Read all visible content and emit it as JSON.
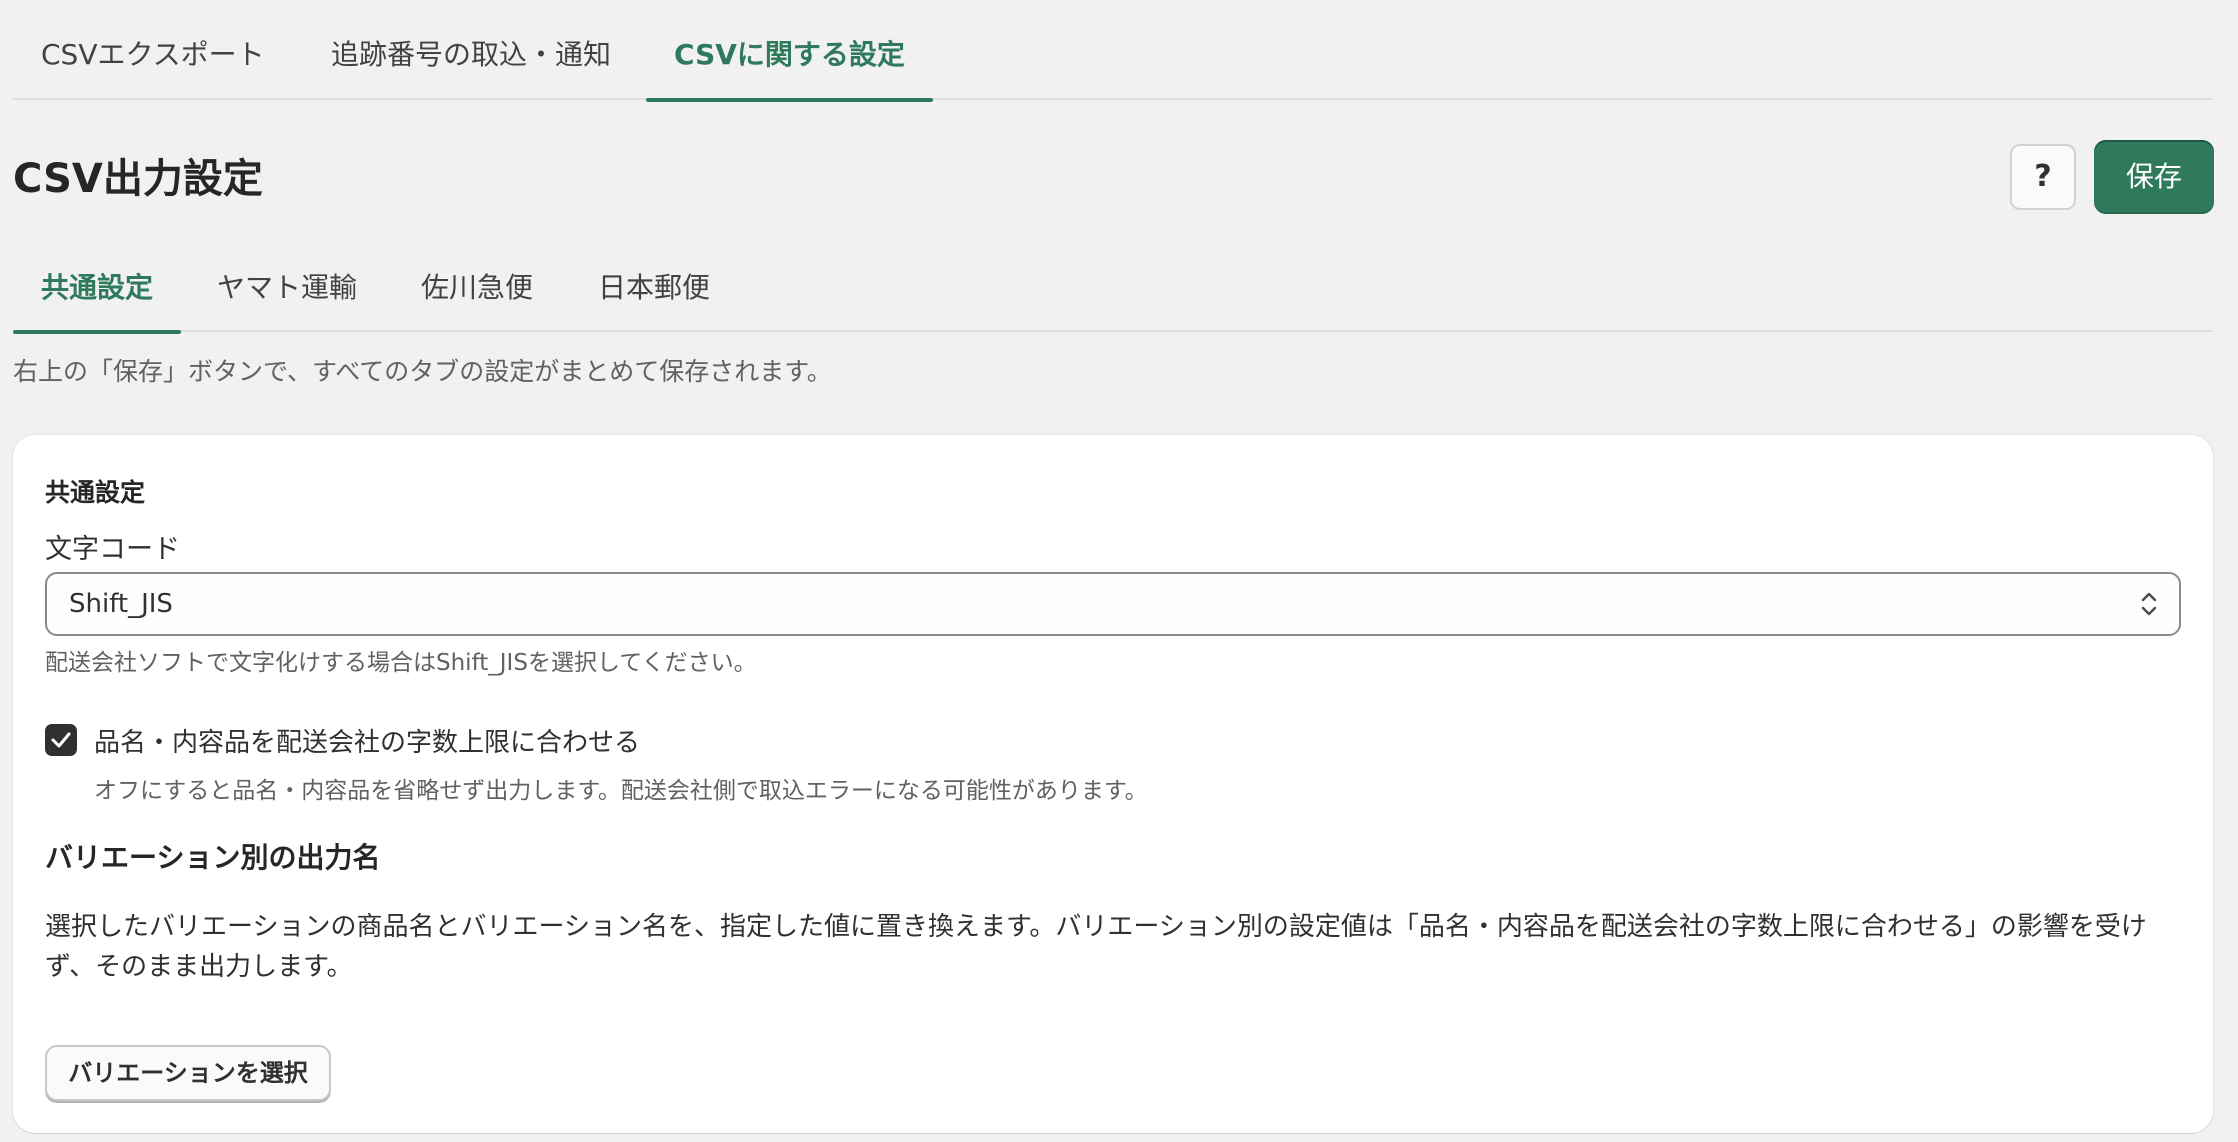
{
  "top_tabs": {
    "csv_export": "CSVエクスポート",
    "tracking_import": "追跡番号の取込・通知",
    "csv_settings": "CSVに関する設定"
  },
  "header": {
    "title": "CSV出力設定",
    "help_label": "?",
    "save_label": "保存"
  },
  "carrier_tabs": {
    "common": "共通設定",
    "yamato": "ヤマト運輸",
    "sagawa": "佐川急便",
    "japan_post": "日本郵便"
  },
  "save_note": "右上の「保存」ボタンで、すべてのタブの設定がまとめて保存されます。",
  "card": {
    "section_title": "共通設定",
    "encoding": {
      "label": "文字コード",
      "value": "Shift_JIS",
      "help": "配送会社ソフトで文字化けする場合はShift_JISを選択してください。"
    },
    "truncate": {
      "checked": true,
      "label": "品名・内容品を配送会社の字数上限に合わせる",
      "help": "オフにすると品名・内容品を省略せず出力します。配送会社側で取込エラーになる可能性があります。"
    },
    "variation": {
      "heading": "バリエーション別の出力名",
      "description": "選択したバリエーションの商品名とバリエーション名を、指定した値に置き換えます。バリエーション別の設定値は「品名・内容品を配送会社の字数上限に合わせる」の影響を受けず、そのまま出力します。",
      "button_label": "バリエーションを選択"
    }
  },
  "colors": {
    "accent": "#2f7a5c",
    "background": "#f1f1f1",
    "card": "#ffffff"
  }
}
